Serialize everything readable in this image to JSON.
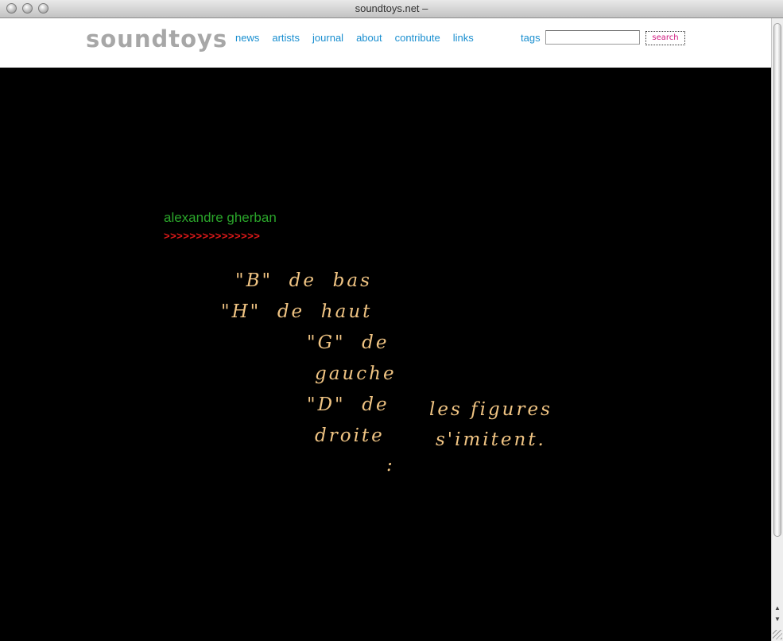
{
  "window": {
    "title": "soundtoys.net –"
  },
  "header": {
    "logo": "soundtoys",
    "nav": [
      "news",
      "artists",
      "journal",
      "about",
      "contribute",
      "links"
    ],
    "tags_label": "tags",
    "tags_input_value": "",
    "search_label": "search"
  },
  "content": {
    "artist_name": "alexandre gherban",
    "arrows": ">>>>>>>>>>>>>>>",
    "poem": [
      "\"B\"  de  bas",
      "\"H\"  de  haut",
      "\"G\"  de",
      "gauche",
      "\"D\"  de",
      "droite",
      ":",
      "les figures",
      "s'imitent."
    ]
  },
  "scrollbar": {
    "up_arrow": "▲",
    "down_arrow": "▼"
  },
  "colors": {
    "nav": "#1a8fd0",
    "artist": "#2aa52a",
    "arrows": "#e01919",
    "poem": "#f0c483",
    "search_text": "#d0187f",
    "logo": "#a7a7a7"
  }
}
